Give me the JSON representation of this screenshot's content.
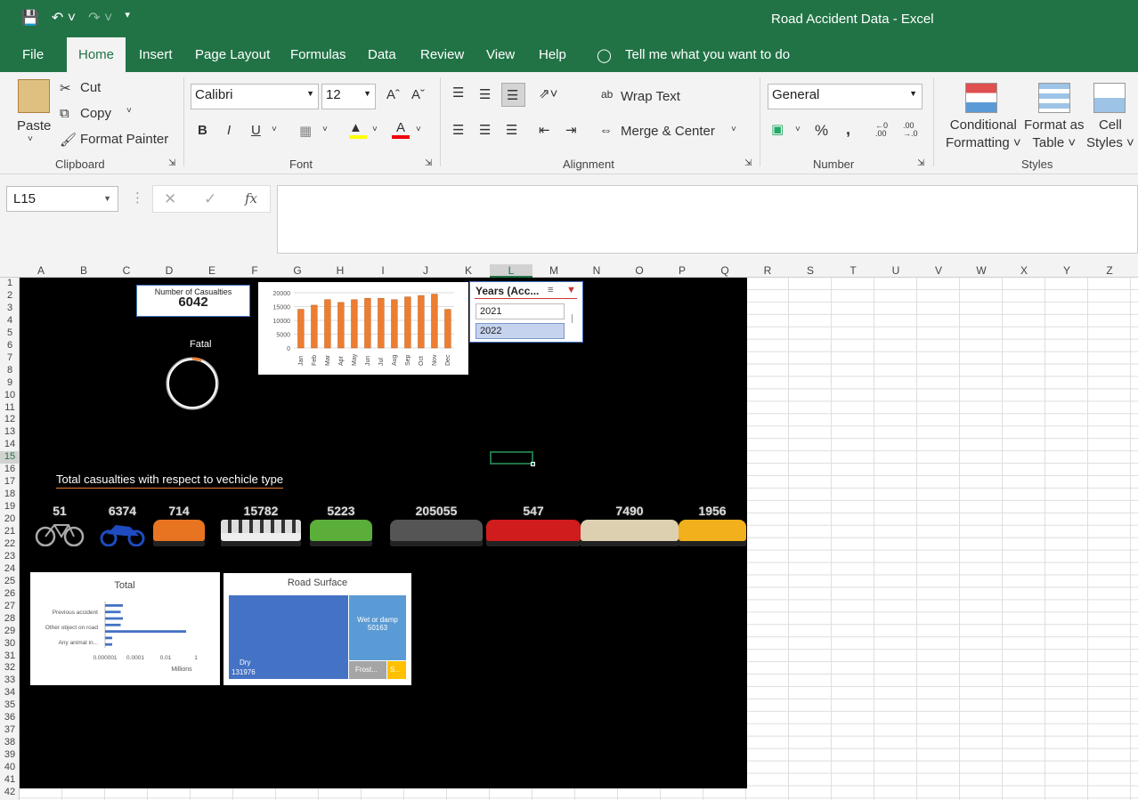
{
  "app": {
    "title": "Road Accident Data  -  Excel"
  },
  "menu": [
    "File",
    "Home",
    "Insert",
    "Page Layout",
    "Formulas",
    "Data",
    "Review",
    "View",
    "Help"
  ],
  "tell_me": "Tell me what you want to do",
  "clipboard": {
    "paste": "Paste",
    "cut": "Cut",
    "copy": "Copy",
    "format_painter": "Format Painter",
    "label": "Clipboard"
  },
  "font": {
    "name": "Calibri",
    "size": "12",
    "bold": "B",
    "italic": "I",
    "underline": "U",
    "label": "Font"
  },
  "alignment": {
    "wrap": "Wrap Text",
    "merge": "Merge & Center",
    "label": "Alignment"
  },
  "number": {
    "format": "General",
    "percent": "%",
    "comma": ",",
    "label": "Number"
  },
  "styles": {
    "conditional": [
      "Conditional",
      "Formatting"
    ],
    "table": [
      "Format as",
      "Table"
    ],
    "cell": [
      "Cell",
      "Styles"
    ],
    "label": "Styles"
  },
  "formula_bar": {
    "name_box": "L15",
    "fx": "fx",
    "value": ""
  },
  "columns": [
    "A",
    "B",
    "C",
    "D",
    "E",
    "F",
    "G",
    "H",
    "I",
    "J",
    "K",
    "L",
    "M",
    "N",
    "O",
    "P",
    "Q",
    "R",
    "S",
    "T",
    "U",
    "V",
    "W",
    "X",
    "Y",
    "Z"
  ],
  "rows": [
    "1",
    "2",
    "3",
    "4",
    "5",
    "6",
    "7",
    "8",
    "9",
    "10",
    "11",
    "12",
    "13",
    "14",
    "15",
    "16",
    "17",
    "18",
    "19",
    "20",
    "21",
    "22",
    "23",
    "24",
    "25",
    "26",
    "27",
    "28",
    "29",
    "30",
    "31",
    "32",
    "33",
    "34",
    "35",
    "36",
    "37",
    "38",
    "39",
    "40",
    "41",
    "42"
  ],
  "kpi": {
    "label": "Number  of  Casualties",
    "value": "6042"
  },
  "fatal": {
    "label": "Fatal",
    "ring_fraction": 0.05
  },
  "slicer": {
    "title": "Years (Acc...",
    "items": [
      "2021",
      "2022"
    ],
    "selected": "2022"
  },
  "vehicle_heading": "Total casualties with respect to vechicle type",
  "vehicles": [
    {
      "icon": "bicycle-icon",
      "value": "51"
    },
    {
      "icon": "motorcycle-icon",
      "value": "6374"
    },
    {
      "icon": "van-icon",
      "value": "714"
    },
    {
      "icon": "bus-icon",
      "value": "15782"
    },
    {
      "icon": "car-icon",
      "value": "5223"
    },
    {
      "icon": "sedan-icon",
      "value": "205055"
    },
    {
      "icon": "tractor-icon",
      "value": "547"
    },
    {
      "icon": "pickup-truck-icon",
      "value": "7490"
    },
    {
      "icon": "excavator-icon",
      "value": "1956"
    }
  ],
  "chart_data": [
    {
      "type": "bar",
      "title": "",
      "categories": [
        "Jan",
        "Feb",
        "Mar",
        "Apr",
        "May",
        "Jun",
        "Jul",
        "Aug",
        "Sep",
        "Oct",
        "Nov",
        "Dec"
      ],
      "values": [
        14000,
        15500,
        17500,
        16500,
        17500,
        18000,
        18000,
        17500,
        18500,
        19000,
        19500,
        14000
      ],
      "yticks": [
        "20000",
        "15000",
        "10000",
        "5000",
        "0"
      ],
      "ylim": [
        0,
        20000
      ],
      "grid": true,
      "color": "#ed7d31"
    },
    {
      "type": "bar",
      "orientation": "horizontal",
      "title": "Total",
      "categories": [
        "Previous accident",
        "Other object on road",
        "Any animal in..."
      ],
      "values": [
        0.02,
        0.015,
        0.02,
        0.015,
        0.4,
        0.005,
        0.005
      ],
      "xticks": [
        "0.000001",
        "0.0001",
        "0.01",
        "1"
      ],
      "xlabel": "Millions",
      "scale": "log",
      "color": "#4472c4"
    },
    {
      "type": "treemap",
      "title": "Road Surface",
      "items": [
        {
          "label": "Dry",
          "value": "131976",
          "color": "#4472c4"
        },
        {
          "label": "Wet or damp",
          "value": "50163",
          "color": "#5b9bd5"
        },
        {
          "label": "Frost...",
          "value": "",
          "color": "#a5a5a5"
        },
        {
          "label": "S...",
          "value": "",
          "color": "#ffc000"
        }
      ]
    }
  ]
}
